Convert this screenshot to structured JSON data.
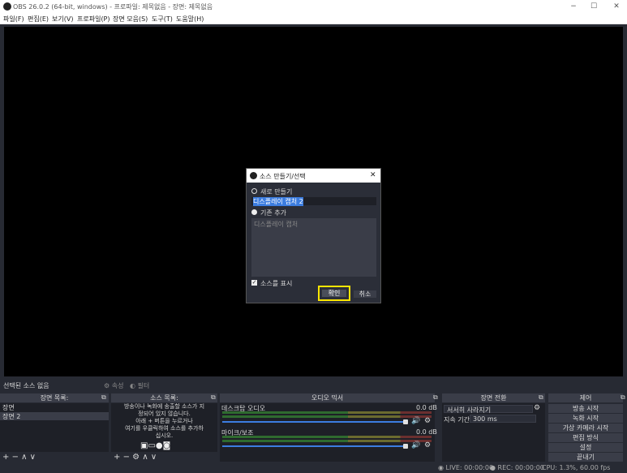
{
  "window": {
    "title": "OBS 26.0.2 (64-bit, windows) - 프로파일: 제목없음 - 장면: 제목없음",
    "minimize": "−",
    "maximize": "☐",
    "close": "✕"
  },
  "menu": {
    "items": [
      "파일(F)",
      "편집(E)",
      "보기(V)",
      "프로파일(P)",
      "장면 모음(S)",
      "도구(T)",
      "도움말(H)"
    ]
  },
  "source_bar": {
    "no_selection": "선택된 소스 없음",
    "properties": "속성",
    "filters": "필터"
  },
  "scenes": {
    "header": "장면 목록:",
    "items": [
      "장면",
      "장면 2"
    ],
    "footer_icons": [
      "+",
      "−",
      "∧",
      "∨"
    ]
  },
  "sources": {
    "header": "소스 목록:",
    "empty_text": "방송이나 녹화에 송출할 소스가 지\n정되어 있지 않습니다.\n아래 + 버튼을 누르거나\n여기를 우클릭하여 소스를 추가하\n십시오.",
    "footer_icons": [
      "+",
      "−",
      "⚙",
      "∧",
      "∨"
    ]
  },
  "mixer": {
    "header": "오디오 믹서",
    "channels": [
      {
        "name": "데스크탑 오디오",
        "level": "0.0 dB"
      },
      {
        "name": "마이크/보조",
        "level": "0.0 dB"
      }
    ]
  },
  "transitions": {
    "header": "장면 전환",
    "selected": "서서히 사라지기",
    "duration_label": "지속 기간",
    "duration_value": "300 ms"
  },
  "controls": {
    "header": "제어",
    "buttons": [
      "방송 시작",
      "녹화 시작",
      "가상 카메라 시작",
      "편집 방식",
      "설정",
      "끝내기"
    ]
  },
  "status": {
    "live": "LIVE: 00:00:00",
    "rec": "REC: 00:00:00",
    "cpu": "CPU: 1.3%, 60.00 fps"
  },
  "dialog": {
    "title": "소스 만들기/선택",
    "close": "✕",
    "create_new_label": "새로 만들기",
    "new_name_value": "디스플레이 캡처 2",
    "add_existing_label": "기존 추가",
    "existing_items": [
      "디스플레이 캡처"
    ],
    "show_source_label": "소스를 표시",
    "ok_label": "확인",
    "cancel_label": "취소"
  },
  "colors": {
    "highlight": "#ffe600",
    "selection": "#3c7de0"
  }
}
